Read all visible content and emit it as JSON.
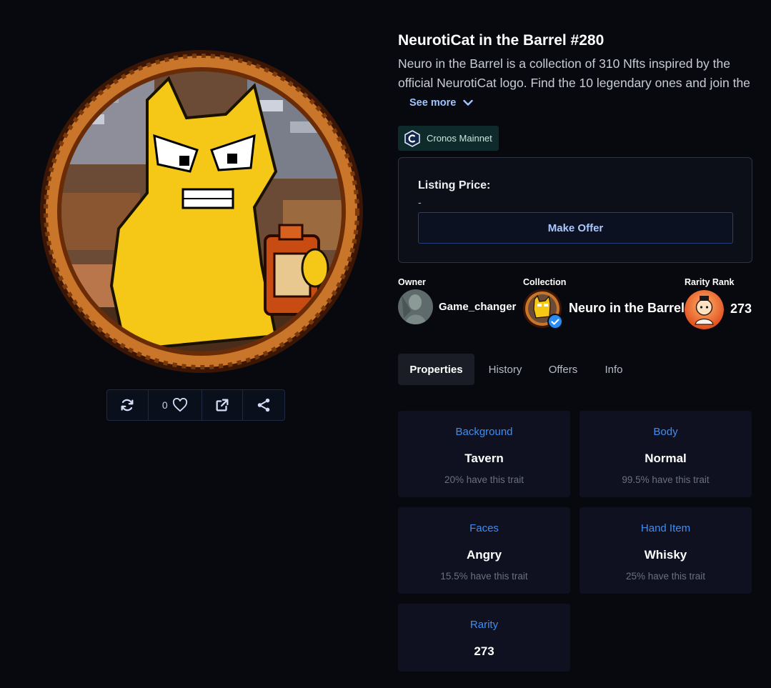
{
  "nft": {
    "title": "NeurotiCat in the Barrel #280",
    "description_line1": "Neuro in the Barrel is a collection of 310 Nfts inspired by the",
    "description_line2": "official NeurotiCat logo. Find the 10 legendary ones and join the",
    "see_more": "See more"
  },
  "chain": {
    "label": "Cronos Mainnet",
    "icon": "cronos-icon"
  },
  "listing": {
    "label": "Listing Price:",
    "value": "-",
    "make_offer": "Make Offer"
  },
  "owner": {
    "label": "Owner",
    "name": "Game_changer"
  },
  "collection": {
    "label": "Collection",
    "name": "Neuro in the Barrel",
    "verified_icon": "check-badge-icon"
  },
  "rarity": {
    "label": "Rarity Rank",
    "value": "273"
  },
  "actions": {
    "likes": "0",
    "icons": [
      "refresh-icon",
      "heart-icon",
      "external-link-icon",
      "share-icon"
    ]
  },
  "tabs": [
    {
      "label": "Properties",
      "active": true
    },
    {
      "label": "History"
    },
    {
      "label": "Offers"
    },
    {
      "label": "Info"
    }
  ],
  "properties": [
    {
      "type": "Background",
      "value": "Tavern",
      "freq": "20% have this trait"
    },
    {
      "type": "Body",
      "value": "Normal",
      "freq": "99.5% have this trait"
    },
    {
      "type": "Faces",
      "value": "Angry",
      "freq": "15.5% have this trait"
    },
    {
      "type": "Hand Item",
      "value": "Whisky",
      "freq": "25% have this trait"
    },
    {
      "type": "Rarity",
      "value": "273",
      "freq": ""
    }
  ],
  "colors": {
    "background": "#07090f",
    "accent_blue": "#3e8ef2",
    "card_bg": "#0f1120",
    "chain_badge_bg": "#0e2a2a"
  }
}
